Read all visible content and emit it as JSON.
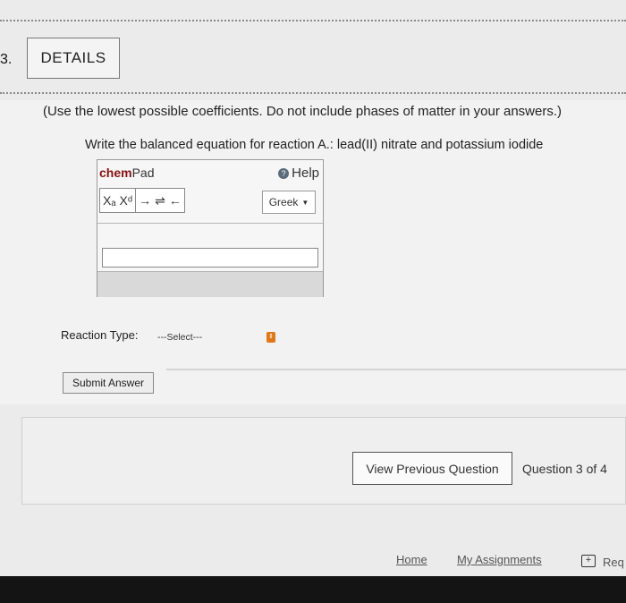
{
  "question": {
    "number": "3.",
    "details_label": "DETAILS",
    "instructions": "(Use the lowest possible coefficients. Do not include phases of matter in your answers.)",
    "prompt": "Write the balanced equation for reaction A.: lead(II) nitrate and potassium iodide"
  },
  "chempad": {
    "title_chem": "chem",
    "title_pad": "Pad",
    "help_label": "Help",
    "tools": {
      "subscript": "Xₐ",
      "superscript": "Xᵈ",
      "arrow": "→",
      "equilibrium": "⇌",
      "back": "←"
    },
    "greek_label": "Greek",
    "input_value": ""
  },
  "reaction_type": {
    "label": "Reaction Type:",
    "selected": "---Select---"
  },
  "submit_label": "Submit Answer",
  "nav": {
    "view_previous": "View Previous Question",
    "question_of": "Question 3 of 4"
  },
  "footer": {
    "home": "Home",
    "my_assignments": "My Assignments",
    "request": "Req"
  },
  "colors": {
    "chem_title": "#8a1010",
    "select_arrow": "#e07818",
    "bottom_bar": "#141414"
  }
}
